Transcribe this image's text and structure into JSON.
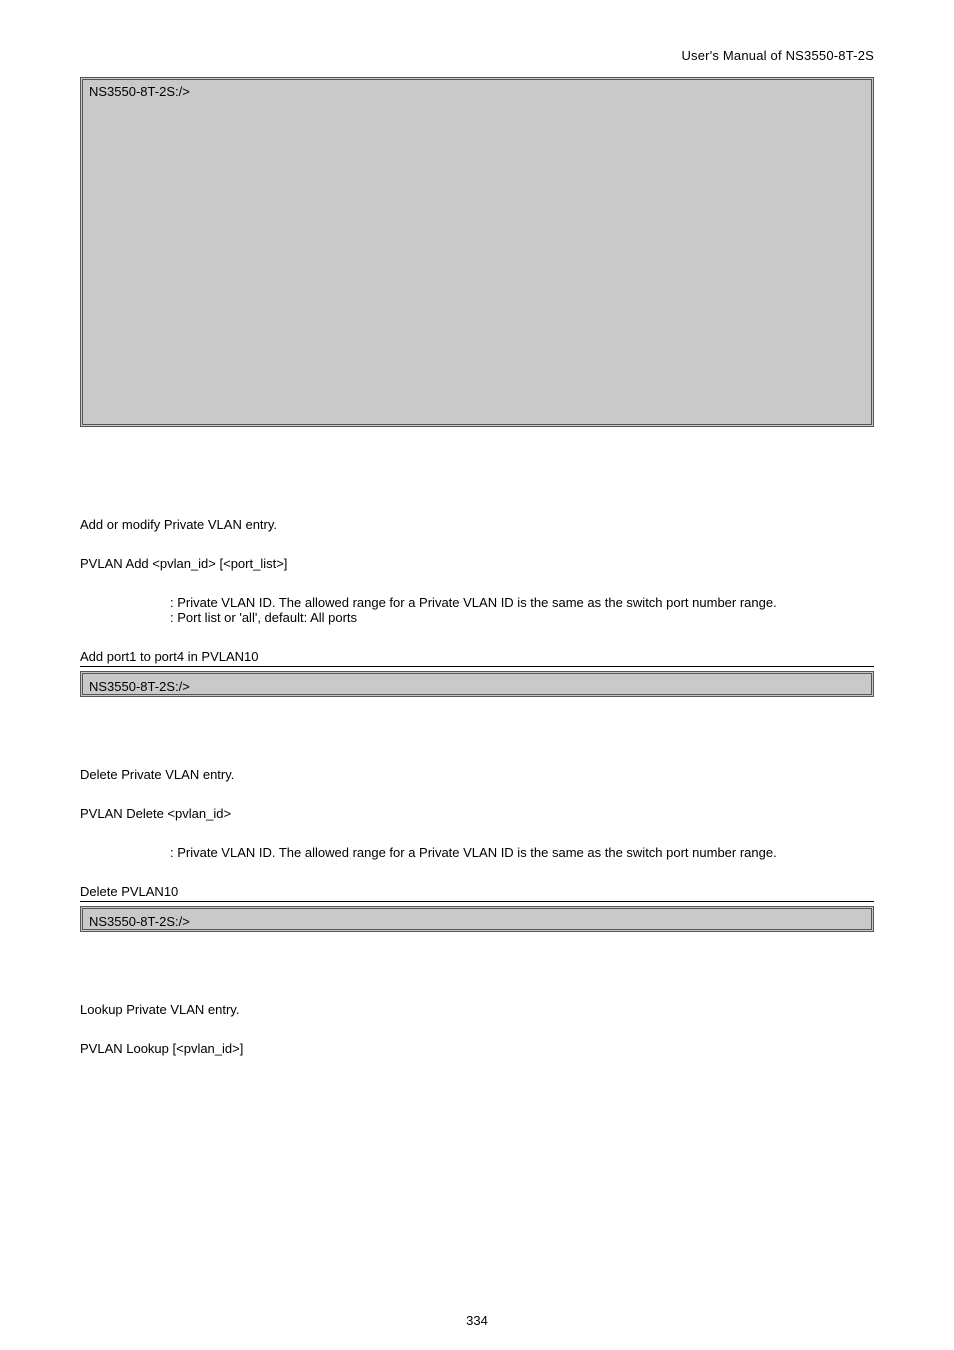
{
  "header": {
    "manual_title": "User's  Manual  of  NS3550-8T-2S"
  },
  "terminal1": {
    "prompt": "NS3550-8T-2S:/>"
  },
  "sections": {
    "add": {
      "desc": "Add or modify Private VLAN entry.",
      "syntax": "PVLAN Add <pvlan_id> [<port_list>]",
      "param1": " : Private VLAN ID. The allowed range for a Private VLAN ID is the same as the switch port number range.",
      "param2": ": Port list or 'all', default: All ports",
      "example": "Add port1 to port4 in PVLAN10",
      "terminal_prompt": "NS3550-8T-2S:/>"
    },
    "delete": {
      "desc": "Delete Private VLAN entry.",
      "syntax": "PVLAN Delete <pvlan_id>",
      "param1": ": Private VLAN ID. The allowed range for a Private VLAN ID is the same as the switch port number range.",
      "example": "Delete PVLAN10",
      "terminal_prompt": "NS3550-8T-2S:/>"
    },
    "lookup": {
      "desc": "Lookup Private VLAN entry.",
      "syntax": "PVLAN Lookup [<pvlan_id>]"
    }
  },
  "page_number": "334"
}
